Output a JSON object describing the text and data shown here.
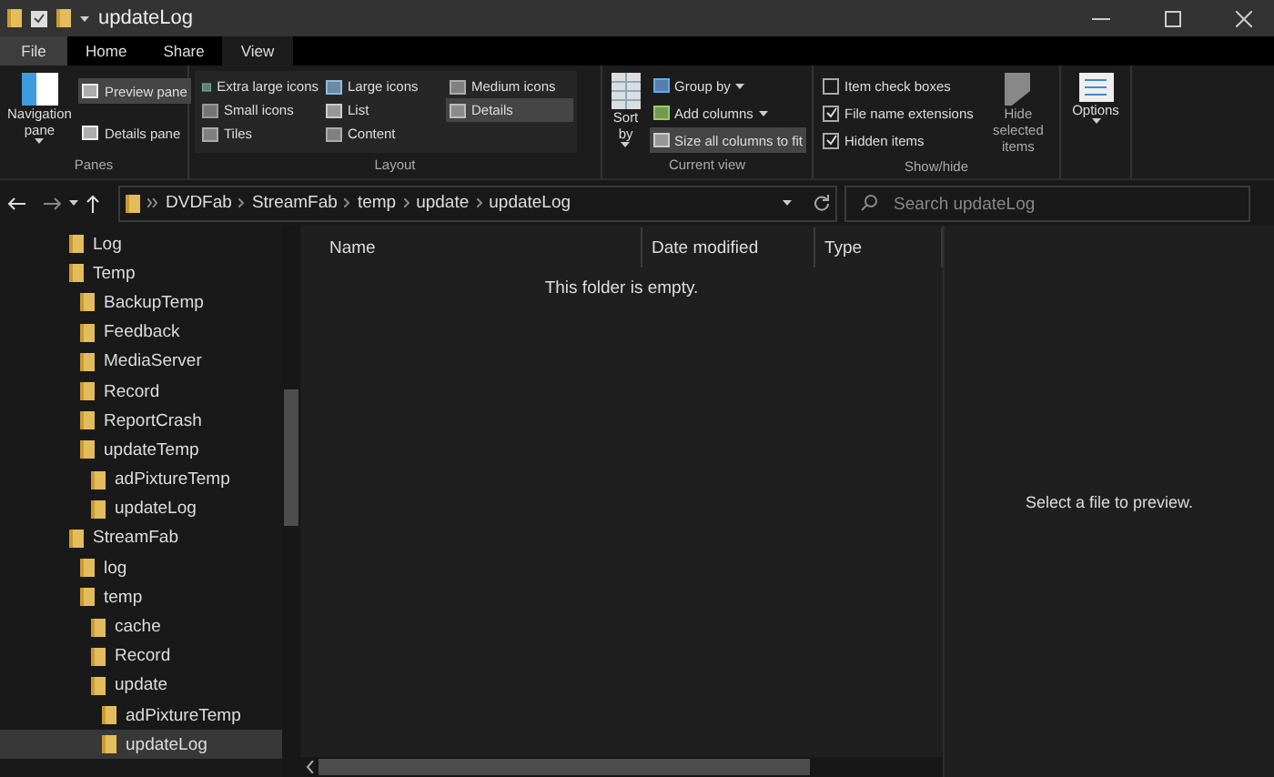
{
  "window": {
    "title": "updateLog"
  },
  "ribbon_tabs": [
    {
      "label": "File",
      "kind": "file",
      "selected": false
    },
    {
      "label": "Home",
      "kind": "tab",
      "selected": false
    },
    {
      "label": "Share",
      "kind": "tab",
      "selected": false
    },
    {
      "label": "View",
      "kind": "tab",
      "selected": true
    }
  ],
  "ribbon": {
    "panes": {
      "label": "Panes",
      "navigation_pane": {
        "label": "Navigation pane"
      },
      "preview_pane": {
        "label": "Preview pane",
        "selected": true
      },
      "details_pane": {
        "label": "Details pane",
        "selected": false
      }
    },
    "layout": {
      "label": "Layout",
      "options": [
        {
          "label": "Extra large icons",
          "selected": false
        },
        {
          "label": "Large icons",
          "selected": false
        },
        {
          "label": "Medium icons",
          "selected": false
        },
        {
          "label": "Small icons",
          "selected": false
        },
        {
          "label": "List",
          "selected": false
        },
        {
          "label": "Details",
          "selected": true
        },
        {
          "label": "Tiles",
          "selected": false
        },
        {
          "label": "Content",
          "selected": false
        }
      ]
    },
    "current_view": {
      "label": "Current view",
      "sort_by": {
        "label": "Sort by"
      },
      "buttons": [
        {
          "label": "Group by",
          "dropdown": true,
          "highlighted": false
        },
        {
          "label": "Add columns",
          "dropdown": true,
          "highlighted": false
        },
        {
          "label": "Size all columns to fit",
          "dropdown": false,
          "highlighted": true
        }
      ]
    },
    "show_hide": {
      "label": "Show/hide",
      "checkboxes": [
        {
          "label": "Item check boxes",
          "checked": false
        },
        {
          "label": "File name extensions",
          "checked": true
        },
        {
          "label": "Hidden items",
          "checked": true
        }
      ],
      "hide_selected": {
        "label": "Hide selected items"
      }
    },
    "options": {
      "label": "Options"
    }
  },
  "address": {
    "path": [
      "DVDFab",
      "StreamFab",
      "temp",
      "update",
      "updateLog"
    ],
    "search": {
      "placeholder": "Search updateLog"
    }
  },
  "navigation_tree": [
    {
      "label": "Log",
      "selected": false
    },
    {
      "label": "Temp",
      "selected": false,
      "children": [
        {
          "label": "BackupTemp",
          "selected": false
        },
        {
          "label": "Feedback",
          "selected": false
        },
        {
          "label": "MediaServer",
          "selected": false
        },
        {
          "label": "Record",
          "selected": false
        },
        {
          "label": "ReportCrash",
          "selected": false
        },
        {
          "label": "updateTemp",
          "selected": false,
          "children": [
            {
              "label": "adPixtureTemp",
              "selected": false
            },
            {
              "label": "updateLog",
              "selected": false
            }
          ]
        }
      ]
    },
    {
      "label": "StreamFab",
      "selected": false,
      "children": [
        {
          "label": "log",
          "selected": false
        },
        {
          "label": "temp",
          "selected": false,
          "children": [
            {
              "label": "cache",
              "selected": false
            },
            {
              "label": "Record",
              "selected": false
            },
            {
              "label": "update",
              "selected": false,
              "children": [
                {
                  "label": "adPixtureTemp",
                  "selected": false
                },
                {
                  "label": "updateLog",
                  "selected": true
                }
              ]
            }
          ]
        }
      ]
    }
  ],
  "file_list": {
    "columns": [
      "Name",
      "Date modified",
      "Type"
    ],
    "empty_message": "This folder is empty."
  },
  "preview_pane": {
    "message": "Select a file to preview."
  }
}
